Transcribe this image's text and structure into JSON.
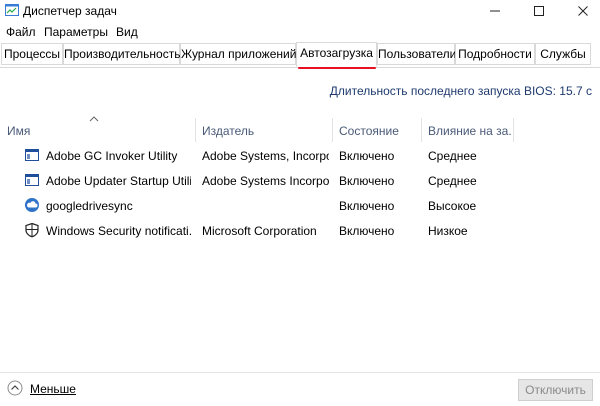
{
  "window": {
    "title": "Диспетчер задач",
    "minimize_icon": "minimize-icon",
    "maximize_icon": "maximize-icon",
    "close_icon": "close-icon"
  },
  "menu": {
    "file": "Файл",
    "options": "Параметры",
    "view": "Вид"
  },
  "tabs": [
    {
      "label": "Процессы"
    },
    {
      "label": "Производительность"
    },
    {
      "label": "Журнал приложений"
    },
    {
      "label": "Автозагрузка",
      "active": true
    },
    {
      "label": "Пользователи"
    },
    {
      "label": "Подробности"
    },
    {
      "label": "Службы"
    }
  ],
  "bios": {
    "label": "Длительность последнего запуска BIOS:",
    "value": "15.7 с"
  },
  "columns": {
    "name": "Имя",
    "publisher": "Издатель",
    "status": "Состояние",
    "impact": "Влияние на за..."
  },
  "rows": [
    {
      "name": "Adobe GC Invoker Utility",
      "publisher": "Adobe Systems, Incorpo...",
      "status": "Включено",
      "impact": "Среднее",
      "icon": "app-window-icon"
    },
    {
      "name": "Adobe Updater Startup Utility",
      "publisher": "Adobe Systems Incorpor...",
      "status": "Включено",
      "impact": "Среднее",
      "icon": "app-window-icon"
    },
    {
      "name": "googledrivesync",
      "publisher": "",
      "status": "Включено",
      "impact": "Высокое",
      "icon": "cloud-icon"
    },
    {
      "name": "Windows Security notificati...",
      "publisher": "Microsoft Corporation",
      "status": "Включено",
      "impact": "Низкое",
      "icon": "shield-icon"
    }
  ],
  "footer": {
    "less": "Меньше",
    "disable": "Отключить"
  },
  "colors": {
    "accent_red": "#e81123",
    "bios_text": "#1e3a6e",
    "header_text": "#4a5a78"
  }
}
